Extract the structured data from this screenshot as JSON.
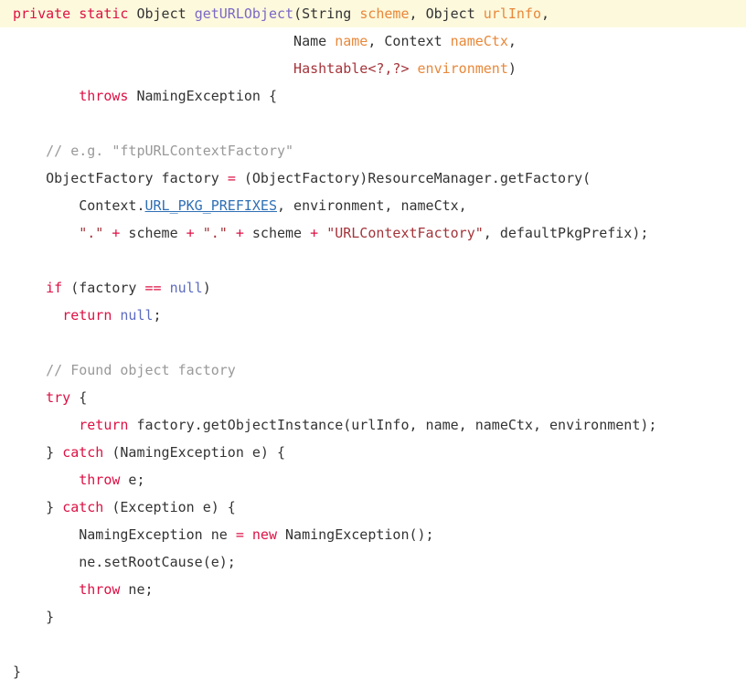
{
  "editor": {
    "language": "Java",
    "background_color": "#ffffff",
    "highlight_color": "#fdf9dd",
    "default_text_color": "#333333"
  },
  "palette": {
    "keyword": "#d14",
    "method": "#7b68c4",
    "param": "#e8883a",
    "string": "#a4343a",
    "comment": "#999999",
    "constant": "#5c6bc0",
    "link": "#2f6fb5",
    "plain": "#333333"
  },
  "code": {
    "lines": [
      {
        "index": 1,
        "highlighted": true,
        "indent": 0,
        "text": "private static Object getURLObject(String scheme, Object urlInfo,",
        "tokens": [
          {
            "t": "private",
            "c": "keyword"
          },
          {
            "t": " ",
            "c": "plain"
          },
          {
            "t": "static",
            "c": "keyword"
          },
          {
            "t": " ",
            "c": "plain"
          },
          {
            "t": "Object",
            "c": "plain"
          },
          {
            "t": " ",
            "c": "plain"
          },
          {
            "t": "getURLObject",
            "c": "method"
          },
          {
            "t": "(",
            "c": "punct"
          },
          {
            "t": "String",
            "c": "plain"
          },
          {
            "t": " ",
            "c": "plain"
          },
          {
            "t": "scheme",
            "c": "param"
          },
          {
            "t": ", ",
            "c": "punct"
          },
          {
            "t": "Object",
            "c": "plain"
          },
          {
            "t": " ",
            "c": "plain"
          },
          {
            "t": "urlInfo",
            "c": "param"
          },
          {
            "t": ",",
            "c": "punct"
          }
        ]
      },
      {
        "index": 2,
        "highlighted": false,
        "indent": 0,
        "text": "                                  Name name, Context nameCtx,",
        "tokens": [
          {
            "t": "                                  ",
            "c": "plain"
          },
          {
            "t": "Name",
            "c": "plain"
          },
          {
            "t": " ",
            "c": "plain"
          },
          {
            "t": "name",
            "c": "param"
          },
          {
            "t": ", ",
            "c": "punct"
          },
          {
            "t": "Context",
            "c": "plain"
          },
          {
            "t": " ",
            "c": "plain"
          },
          {
            "t": "nameCtx",
            "c": "param"
          },
          {
            "t": ",",
            "c": "punct"
          }
        ]
      },
      {
        "index": 3,
        "highlighted": false,
        "indent": 0,
        "text": "                                  Hashtable<?,?> environment)",
        "tokens": [
          {
            "t": "                                  ",
            "c": "plain"
          },
          {
            "t": "Hashtable<?,?>",
            "c": "generic"
          },
          {
            "t": " ",
            "c": "plain"
          },
          {
            "t": "environment",
            "c": "param"
          },
          {
            "t": ")",
            "c": "punct"
          }
        ]
      },
      {
        "index": 4,
        "highlighted": false,
        "indent": 0,
        "text": "        throws NamingException {",
        "tokens": [
          {
            "t": "        ",
            "c": "plain"
          },
          {
            "t": "throws",
            "c": "keyword"
          },
          {
            "t": " ",
            "c": "plain"
          },
          {
            "t": "NamingException",
            "c": "plain"
          },
          {
            "t": " {",
            "c": "punct"
          }
        ]
      },
      {
        "index": 5,
        "highlighted": false,
        "indent": 0,
        "text": "",
        "tokens": []
      },
      {
        "index": 6,
        "highlighted": false,
        "indent": 0,
        "text": "    // e.g. \"ftpURLContextFactory\"",
        "tokens": [
          {
            "t": "    ",
            "c": "plain"
          },
          {
            "t": "// e.g. \"ftpURLContextFactory\"",
            "c": "comment"
          }
        ]
      },
      {
        "index": 7,
        "highlighted": false,
        "indent": 0,
        "text": "    ObjectFactory factory = (ObjectFactory)ResourceManager.getFactory(",
        "tokens": [
          {
            "t": "    ",
            "c": "plain"
          },
          {
            "t": "ObjectFactory factory ",
            "c": "plain"
          },
          {
            "t": "=",
            "c": "operator"
          },
          {
            "t": " (ObjectFactory)ResourceManager.getFactory(",
            "c": "plain"
          }
        ]
      },
      {
        "index": 8,
        "highlighted": false,
        "indent": 0,
        "text": "        Context.URL_PKG_PREFIXES, environment, nameCtx,",
        "tokens": [
          {
            "t": "        ",
            "c": "plain"
          },
          {
            "t": "Context.",
            "c": "plain"
          },
          {
            "t": "URL_PKG_PREFIXES",
            "c": "link"
          },
          {
            "t": ", environment, nameCtx,",
            "c": "plain"
          }
        ]
      },
      {
        "index": 9,
        "highlighted": false,
        "indent": 0,
        "text": "        \".\" + scheme + \".\" + scheme + \"URLContextFactory\", defaultPkgPrefix);",
        "tokens": [
          {
            "t": "        ",
            "c": "plain"
          },
          {
            "t": "\".\"",
            "c": "string"
          },
          {
            "t": " ",
            "c": "plain"
          },
          {
            "t": "+",
            "c": "operator"
          },
          {
            "t": " scheme ",
            "c": "plain"
          },
          {
            "t": "+",
            "c": "operator"
          },
          {
            "t": " ",
            "c": "plain"
          },
          {
            "t": "\".\"",
            "c": "string"
          },
          {
            "t": " ",
            "c": "plain"
          },
          {
            "t": "+",
            "c": "operator"
          },
          {
            "t": " scheme ",
            "c": "plain"
          },
          {
            "t": "+",
            "c": "operator"
          },
          {
            "t": " ",
            "c": "plain"
          },
          {
            "t": "\"URLContextFactory\"",
            "c": "string"
          },
          {
            "t": ", defaultPkgPrefix);",
            "c": "plain"
          }
        ]
      },
      {
        "index": 10,
        "highlighted": false,
        "indent": 0,
        "text": "",
        "tokens": []
      },
      {
        "index": 11,
        "highlighted": false,
        "indent": 0,
        "text": "    if (factory == null)",
        "tokens": [
          {
            "t": "    ",
            "c": "plain"
          },
          {
            "t": "if",
            "c": "keyword"
          },
          {
            "t": " (factory ",
            "c": "plain"
          },
          {
            "t": "==",
            "c": "operator"
          },
          {
            "t": " ",
            "c": "plain"
          },
          {
            "t": "null",
            "c": "const"
          },
          {
            "t": ")",
            "c": "punct"
          }
        ]
      },
      {
        "index": 12,
        "highlighted": false,
        "indent": 0,
        "text": "      return null;",
        "tokens": [
          {
            "t": "      ",
            "c": "plain"
          },
          {
            "t": "return",
            "c": "keyword"
          },
          {
            "t": " ",
            "c": "plain"
          },
          {
            "t": "null",
            "c": "const"
          },
          {
            "t": ";",
            "c": "punct"
          }
        ]
      },
      {
        "index": 13,
        "highlighted": false,
        "indent": 0,
        "text": "",
        "tokens": []
      },
      {
        "index": 14,
        "highlighted": false,
        "indent": 0,
        "text": "    // Found object factory",
        "tokens": [
          {
            "t": "    ",
            "c": "plain"
          },
          {
            "t": "// Found object factory",
            "c": "comment"
          }
        ]
      },
      {
        "index": 15,
        "highlighted": false,
        "indent": 0,
        "text": "    try {",
        "tokens": [
          {
            "t": "    ",
            "c": "plain"
          },
          {
            "t": "try",
            "c": "keyword"
          },
          {
            "t": " {",
            "c": "punct"
          }
        ]
      },
      {
        "index": 16,
        "highlighted": false,
        "indent": 0,
        "text": "        return factory.getObjectInstance(urlInfo, name, nameCtx, environment);",
        "tokens": [
          {
            "t": "        ",
            "c": "plain"
          },
          {
            "t": "return",
            "c": "keyword"
          },
          {
            "t": " factory.getObjectInstance(urlInfo, name, nameCtx, environment);",
            "c": "plain"
          }
        ]
      },
      {
        "index": 17,
        "highlighted": false,
        "indent": 0,
        "text": "    } catch (NamingException e) {",
        "tokens": [
          {
            "t": "    } ",
            "c": "plain"
          },
          {
            "t": "catch",
            "c": "keyword"
          },
          {
            "t": " (NamingException e) {",
            "c": "plain"
          }
        ]
      },
      {
        "index": 18,
        "highlighted": false,
        "indent": 0,
        "text": "        throw e;",
        "tokens": [
          {
            "t": "        ",
            "c": "plain"
          },
          {
            "t": "throw",
            "c": "keyword"
          },
          {
            "t": " e;",
            "c": "plain"
          }
        ]
      },
      {
        "index": 19,
        "highlighted": false,
        "indent": 0,
        "text": "    } catch (Exception e) {",
        "tokens": [
          {
            "t": "    } ",
            "c": "plain"
          },
          {
            "t": "catch",
            "c": "keyword"
          },
          {
            "t": " (Exception e) {",
            "c": "plain"
          }
        ]
      },
      {
        "index": 20,
        "highlighted": false,
        "indent": 0,
        "text": "        NamingException ne = new NamingException();",
        "tokens": [
          {
            "t": "        ",
            "c": "plain"
          },
          {
            "t": "NamingException ne ",
            "c": "plain"
          },
          {
            "t": "=",
            "c": "operator"
          },
          {
            "t": " ",
            "c": "plain"
          },
          {
            "t": "new",
            "c": "keyword"
          },
          {
            "t": " NamingException();",
            "c": "plain"
          }
        ]
      },
      {
        "index": 21,
        "highlighted": false,
        "indent": 0,
        "text": "        ne.setRootCause(e);",
        "tokens": [
          {
            "t": "        ne.setRootCause(e);",
            "c": "plain"
          }
        ]
      },
      {
        "index": 22,
        "highlighted": false,
        "indent": 0,
        "text": "        throw ne;",
        "tokens": [
          {
            "t": "        ",
            "c": "plain"
          },
          {
            "t": "throw",
            "c": "keyword"
          },
          {
            "t": " ne;",
            "c": "plain"
          }
        ]
      },
      {
        "index": 23,
        "highlighted": false,
        "indent": 0,
        "text": "    }",
        "tokens": [
          {
            "t": "    }",
            "c": "plain"
          }
        ]
      },
      {
        "index": 24,
        "highlighted": false,
        "indent": 0,
        "text": "",
        "tokens": []
      },
      {
        "index": 25,
        "highlighted": false,
        "indent": 0,
        "text": "}",
        "tokens": [
          {
            "t": "}",
            "c": "plain"
          }
        ]
      }
    ]
  }
}
